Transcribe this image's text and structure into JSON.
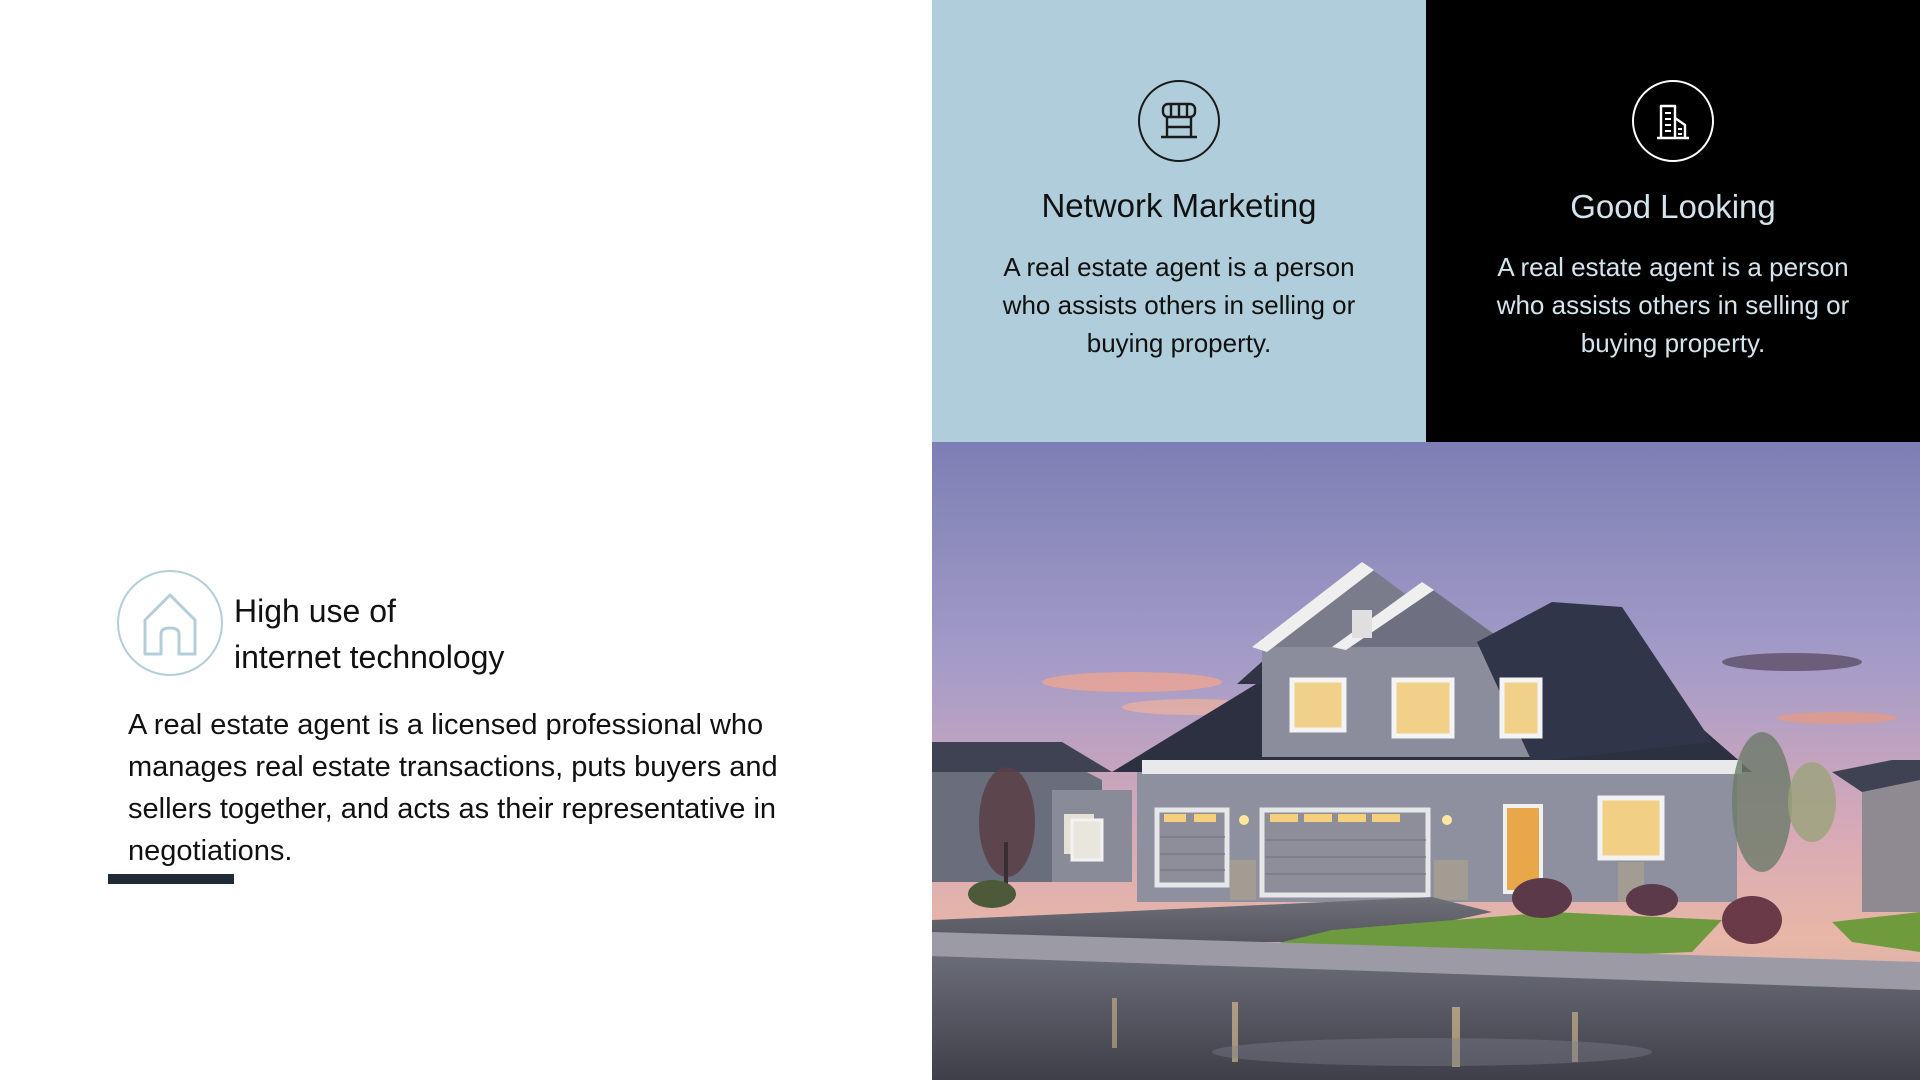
{
  "feature": {
    "icon": "house-outline-icon",
    "title_line1": "High use of",
    "title_line2": "internet technology",
    "body": "A real estate agent is a licensed professional who manages real estate transactions, puts buyers and sellers together, and acts as their representative in negotiations."
  },
  "cards": [
    {
      "icon": "storefront-icon",
      "title": "Network Marketing",
      "body": "A real estate agent is a person who assists others in selling or buying property.",
      "background": "#b0cddb"
    },
    {
      "icon": "building-icon",
      "title": "Good Looking",
      "body": "A real estate agent is a person who assists others in selling or buying property.",
      "background": "#000000"
    }
  ],
  "photo": {
    "subject": "house-at-dusk-image"
  },
  "colors": {
    "accent_blue": "#b0cddb",
    "underline": "#1f2a35",
    "text_dark": "#111111"
  }
}
